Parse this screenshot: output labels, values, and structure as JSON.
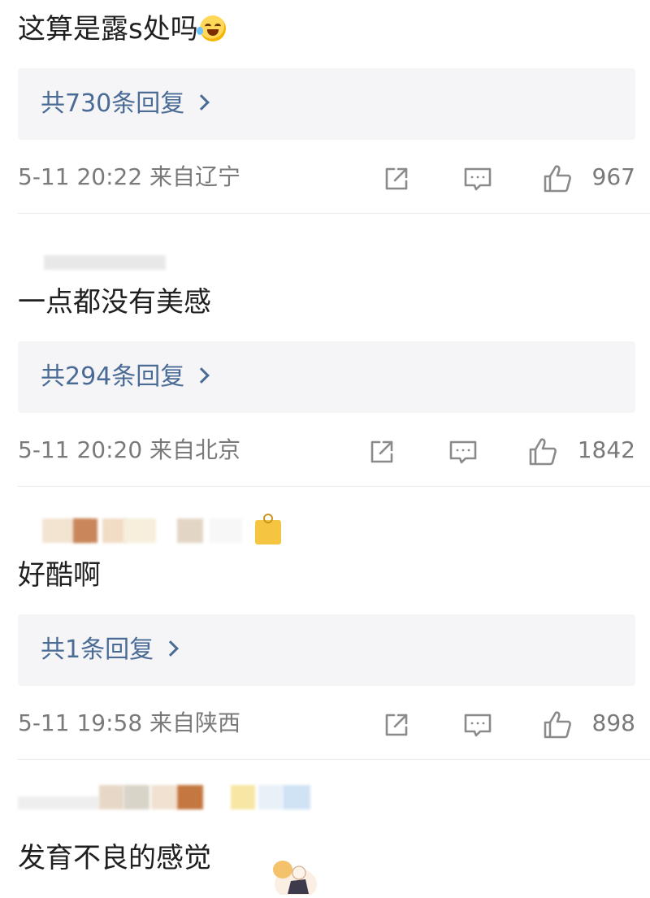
{
  "comments": [
    {
      "text": "这算是露s处吗",
      "replies_label": "共730条回复",
      "timestamp_location": "5-11 20:22 来自辽宁",
      "likes": "967"
    },
    {
      "text": "一点都没有美感",
      "replies_label": "共294条回复",
      "timestamp_location": "5-11 20:20 来自北京",
      "likes": "1842"
    },
    {
      "text": "好酷啊",
      "replies_label": "共1条回复",
      "timestamp_location": "5-11 19:58 来自陕西",
      "likes": "898"
    },
    {
      "text": "发育不良的感觉"
    }
  ],
  "icons": {
    "share": "share-icon",
    "comment": "comment-icon",
    "like": "thumbs-up-icon",
    "chevron": "chevron-right-icon"
  },
  "colors": {
    "link": "#4a6b96",
    "meta": "#7a7a7a",
    "reply_bg": "#f5f5f7",
    "divider": "#e9e9ee"
  }
}
